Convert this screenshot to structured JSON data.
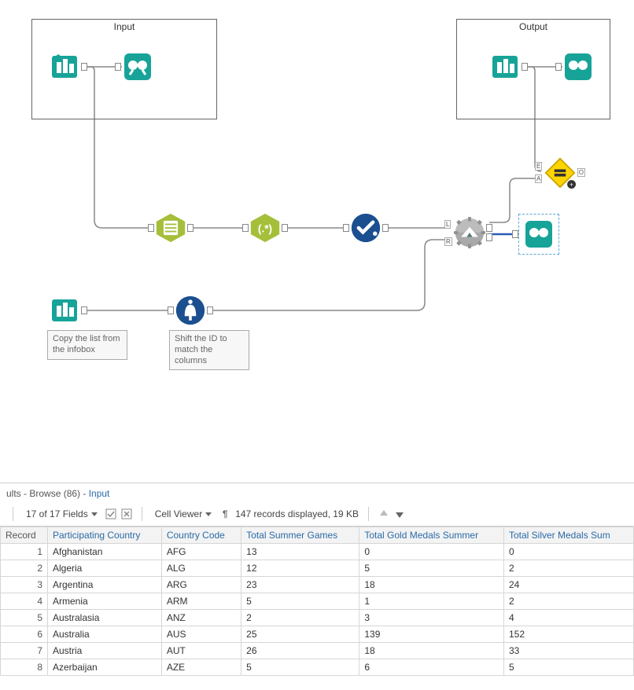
{
  "containers": {
    "input": {
      "title": "Input"
    },
    "output": {
      "title": "Output"
    }
  },
  "annotations": {
    "copy": "Copy the list from the infobox",
    "shift": "Shift the ID to match the columns"
  },
  "join_ports": {
    "e": "E",
    "a": "A",
    "o": "O",
    "l": "L",
    "r": "R"
  },
  "results": {
    "header_prefix": "ults",
    "header_mid": " - Browse (86) - ",
    "header_suffix": "Input",
    "fields_label": "17 of 17 Fields",
    "cell_viewer_label": "Cell Viewer",
    "records_label": "147 records displayed, 19 KB",
    "columns": [
      "Record",
      "Participating Country",
      "Country Code",
      "Total Summer Games",
      "Total Gold Medals Summer",
      "Total Silver Medals Sum"
    ],
    "rows": [
      [
        "1",
        "Afghanistan",
        "AFG",
        "13",
        "0",
        "0"
      ],
      [
        "2",
        "Algeria",
        "ALG",
        "12",
        "5",
        "2"
      ],
      [
        "3",
        "Argentina",
        "ARG",
        "23",
        "18",
        "24"
      ],
      [
        "4",
        "Armenia",
        "ARM",
        "5",
        "1",
        "2"
      ],
      [
        "5",
        "Australasia",
        "ANZ",
        "2",
        "3",
        "4"
      ],
      [
        "6",
        "Australia",
        "AUS",
        "25",
        "139",
        "152"
      ],
      [
        "7",
        "Austria",
        "AUT",
        "26",
        "18",
        "33"
      ],
      [
        "8",
        "Azerbaijan",
        "AZE",
        "5",
        "6",
        "5"
      ]
    ]
  }
}
